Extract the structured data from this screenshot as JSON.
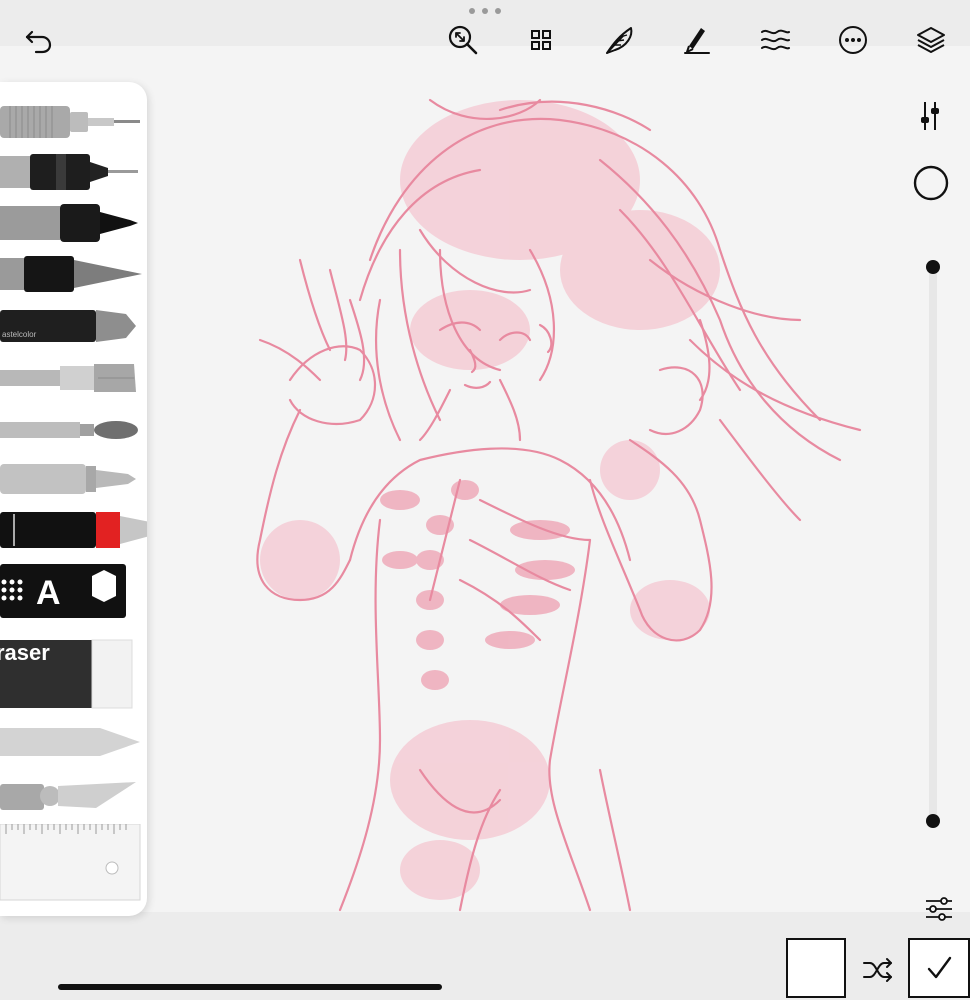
{
  "toolbar": {
    "undo_icon": "undo-icon",
    "zoom_icon": "zoom-icon",
    "gallery_icon": "grid-icon",
    "brush_icon": "feather-icon",
    "ink_icon": "pen-icon",
    "water_icon": "water-wave-icon",
    "more_icon": "more-icon",
    "layers_icon": "layers-icon"
  },
  "tools": [
    {
      "name": "technical-pen"
    },
    {
      "name": "fineliner"
    },
    {
      "name": "marker"
    },
    {
      "name": "brush-pen"
    },
    {
      "name": "pastel",
      "label": "astelcolor"
    },
    {
      "name": "flat-brush"
    },
    {
      "name": "round-brush"
    },
    {
      "name": "pencil"
    },
    {
      "name": "fountain-pen"
    },
    {
      "name": "fill-text-shape",
      "label": "A"
    },
    {
      "name": "eraser",
      "label": "raser"
    },
    {
      "name": "blender"
    },
    {
      "name": "knife"
    },
    {
      "name": "ruler"
    }
  ],
  "side": {
    "settings_icon": "sliders-icon",
    "size_icon": "brush-size-circle-icon",
    "bottom_settings_icon": "adjustments-icon"
  },
  "brush_slider": {
    "top": 0.0,
    "bottom": 1.0
  },
  "colors": {
    "accent": "#111111",
    "sketch": "#e88aa0",
    "sketch_fill": "#f4c7d1",
    "current_color": "#ffffff",
    "fountain_band": "#e22222"
  },
  "bottom": {
    "shuffle_icon": "shuffle-icon",
    "confirm_icon": "checkmark-icon"
  }
}
